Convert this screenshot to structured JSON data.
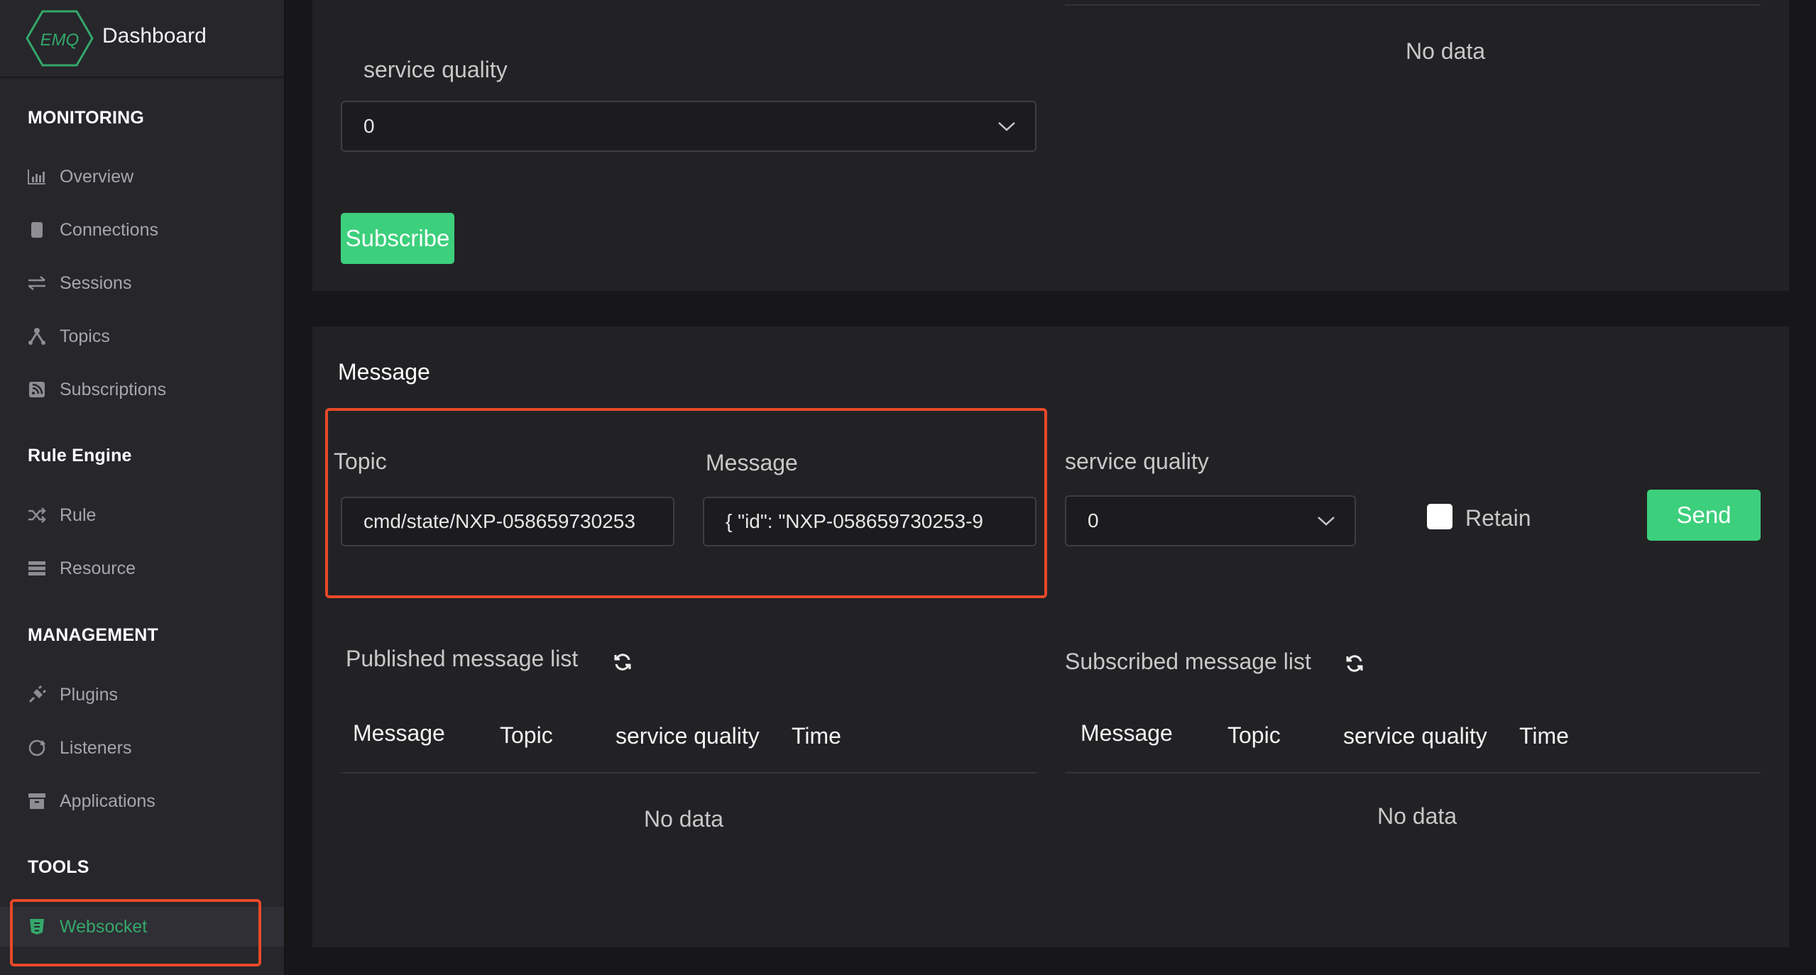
{
  "app": {
    "logo_text": "EMQ",
    "title": "Dashboard"
  },
  "sidebar": {
    "sections": {
      "monitoring": "MONITORING",
      "rule_engine": "Rule Engine",
      "management": "MANAGEMENT",
      "tools": "TOOLS"
    },
    "items": [
      {
        "label": "Overview",
        "icon": "bar-chart-icon"
      },
      {
        "label": "Connections",
        "icon": "phone-icon"
      },
      {
        "label": "Sessions",
        "icon": "swap-icon"
      },
      {
        "label": "Topics",
        "icon": "topic-branch-icon"
      },
      {
        "label": "Subscriptions",
        "icon": "rss-icon"
      },
      {
        "label": "Rule",
        "icon": "shuffle-icon"
      },
      {
        "label": "Resource",
        "icon": "server-icon"
      },
      {
        "label": "Plugins",
        "icon": "plug-icon"
      },
      {
        "label": "Listeners",
        "icon": "circle-arrow-icon"
      },
      {
        "label": "Applications",
        "icon": "box-icon"
      },
      {
        "label": "Websocket",
        "icon": "html5-icon",
        "active": true
      }
    ]
  },
  "subscribe": {
    "qos_label": "service quality",
    "qos_value": "0",
    "subscribe_button": "Subscribe",
    "no_data": "No data"
  },
  "message": {
    "section_title": "Message",
    "topic_label": "Topic",
    "topic_value": "cmd/state/NXP-058659730253",
    "message_label": "Message",
    "message_value": "{   \"id\": \"NXP-058659730253-9",
    "qos_label": "service quality",
    "qos_value": "0",
    "retain_label": "Retain",
    "send_button": "Send"
  },
  "published_list": {
    "title": "Published message list",
    "columns": [
      "Message",
      "Topic",
      "service quality",
      "Time"
    ],
    "no_data": "No data"
  },
  "subscribed_list": {
    "title": "Subscribed message list",
    "columns": [
      "Message",
      "Topic",
      "service quality",
      "Time"
    ],
    "no_data": "No data"
  },
  "colors": {
    "accent": "#3ccf7c",
    "highlight": "#e8492a",
    "background": "#17171a",
    "panel": "#222225"
  }
}
